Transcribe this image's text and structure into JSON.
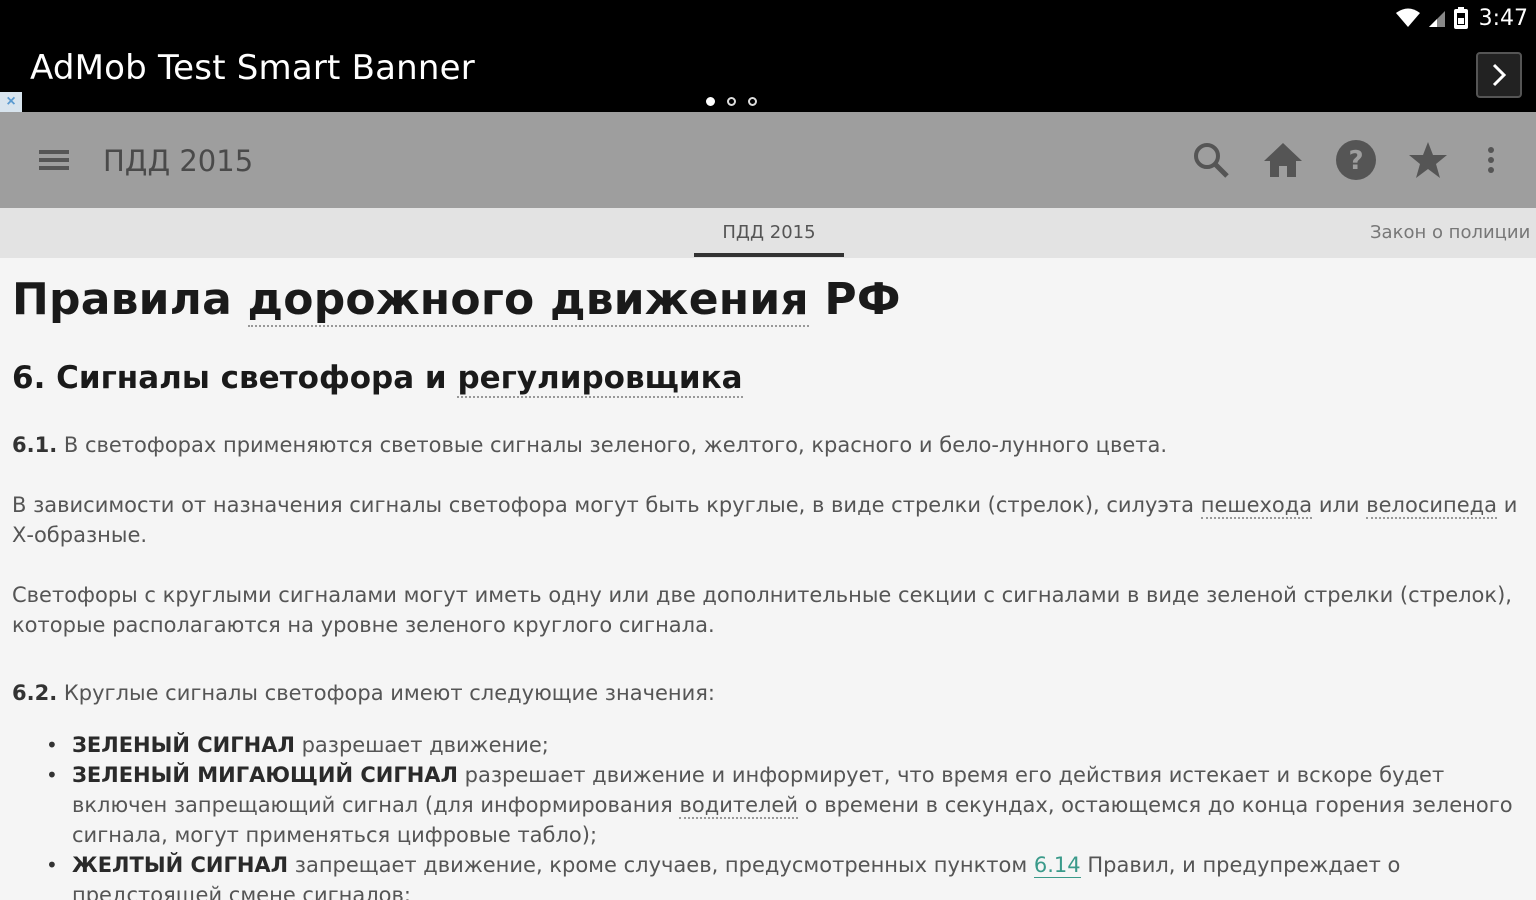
{
  "status_bar": {
    "time": "3:47"
  },
  "ad_banner": {
    "title": "AdMob Test Smart Banner",
    "close": "×",
    "dots": 3
  },
  "toolbar": {
    "title": "ПДД 2015"
  },
  "tabs": [
    {
      "label": "ПДД 2015",
      "active": true
    },
    {
      "label": "Закон о полиции",
      "active": false
    }
  ],
  "document": {
    "heading_pre": "Правила ",
    "heading_link": "дорожного движения",
    "heading_post": " РФ",
    "section_pre": "6. Сигналы светофора и ",
    "section_link": "регулировщика",
    "p1_num": "6.1.",
    "p1_text": " В светофорах применяются световые сигналы зеленого, желтого, красного и бело-лунного цвета.",
    "p2_pre": "В зависимости от назначения сигналы светофора могут быть круглые, в виде стрелки (стрелок), силуэта ",
    "p2_link1": "пешехода",
    "p2_mid": " или ",
    "p2_link2": "велосипеда",
    "p2_post": " и Х-образные.",
    "p3_text": "Светофоры с круглыми сигналами могут иметь одну или две дополнительные секции с сигналами в виде зеленой стрелки (стрелок), которые располагаются на уровне зеленого круглого сигнала.",
    "p4_num": "6.2.",
    "p4_text": " Круглые сигналы светофора имеют следующие значения:",
    "items": [
      {
        "term": "ЗЕЛЕНЫЙ СИГНАЛ",
        "text": " разрешает движение;"
      },
      {
        "term": "ЗЕЛЕНЫЙ МИГАЮЩИЙ СИГНАЛ",
        "text_pre": " разрешает движение и информирует, что время его действия истекает и вскоре будет включен запрещающий сигнал (для информирования ",
        "link": "водителей",
        "text_post": " о времени в секундах, остающемся до конца горения зеленого сигнала, могут применяться цифровые табло);"
      },
      {
        "term": "ЖЕЛТЫЙ СИГНАЛ",
        "text_pre": " запрещает движение, кроме случаев, предусмотренных пунктом ",
        "link": "6.14",
        "text_post": " Правил, и предупреждает о предстоящей смене сигналов;"
      }
    ]
  },
  "icons": {
    "menu": "menu-icon",
    "search": "search-icon",
    "home": "home-icon",
    "help": "help-icon",
    "favorite": "star-icon",
    "overflow": "more-vert-icon",
    "ad_next": "chevron-right-icon"
  }
}
